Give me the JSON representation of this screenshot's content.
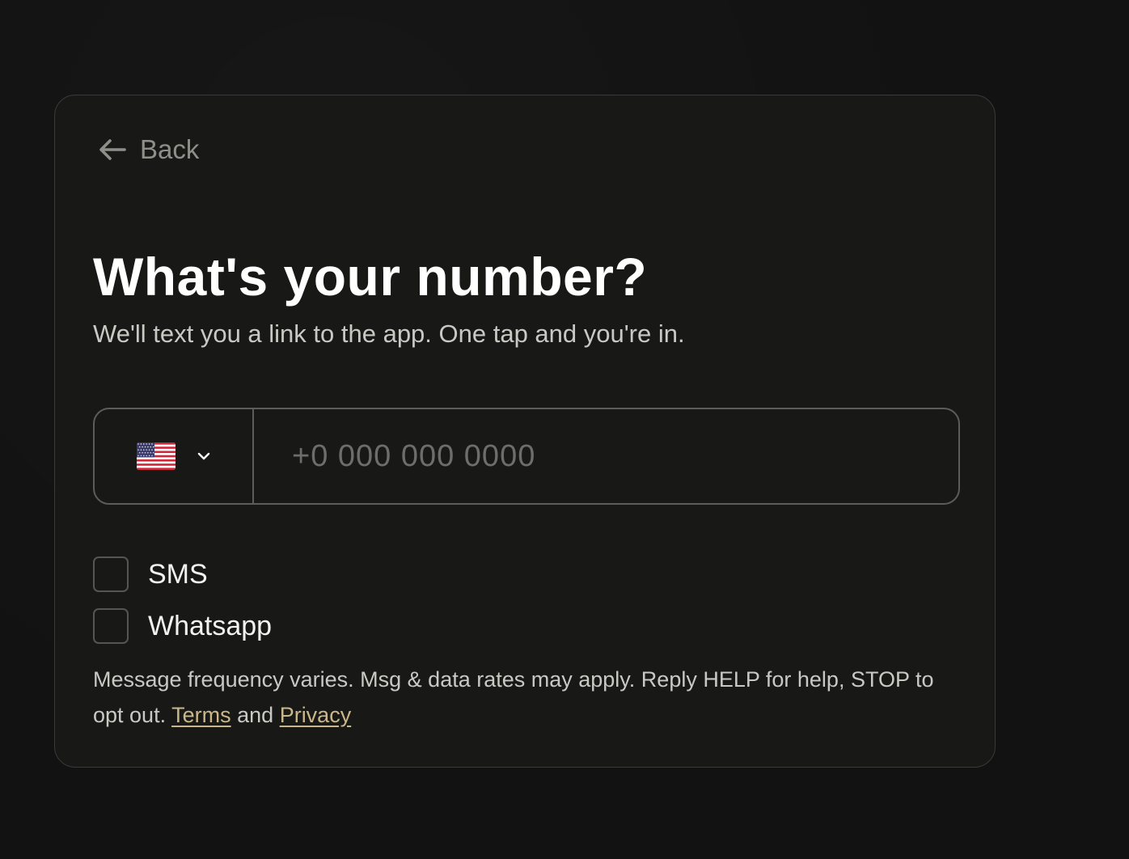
{
  "back": {
    "label": "Back",
    "icon": "arrow-left-icon"
  },
  "header": {
    "title": "What's your number?",
    "subtitle": "We'll text you a link to the app. One tap and you're in."
  },
  "phone": {
    "country_flag": "us-flag-icon",
    "dropdown_icon": "chevron-down-icon",
    "value": "",
    "placeholder": "+0 000 000 0000"
  },
  "options": {
    "sms": {
      "label": "SMS",
      "checked": false
    },
    "whatsapp": {
      "label": "Whatsapp",
      "checked": false
    }
  },
  "legal": {
    "text": "Message frequency varies. Msg & data rates may apply. Reply HELP for help, STOP to opt out.",
    "terms_label": "Terms",
    "and_label": "and",
    "privacy_label": "Privacy"
  },
  "colors": {
    "background": "#121212",
    "card": "#181917",
    "link": "#c9b78a"
  }
}
